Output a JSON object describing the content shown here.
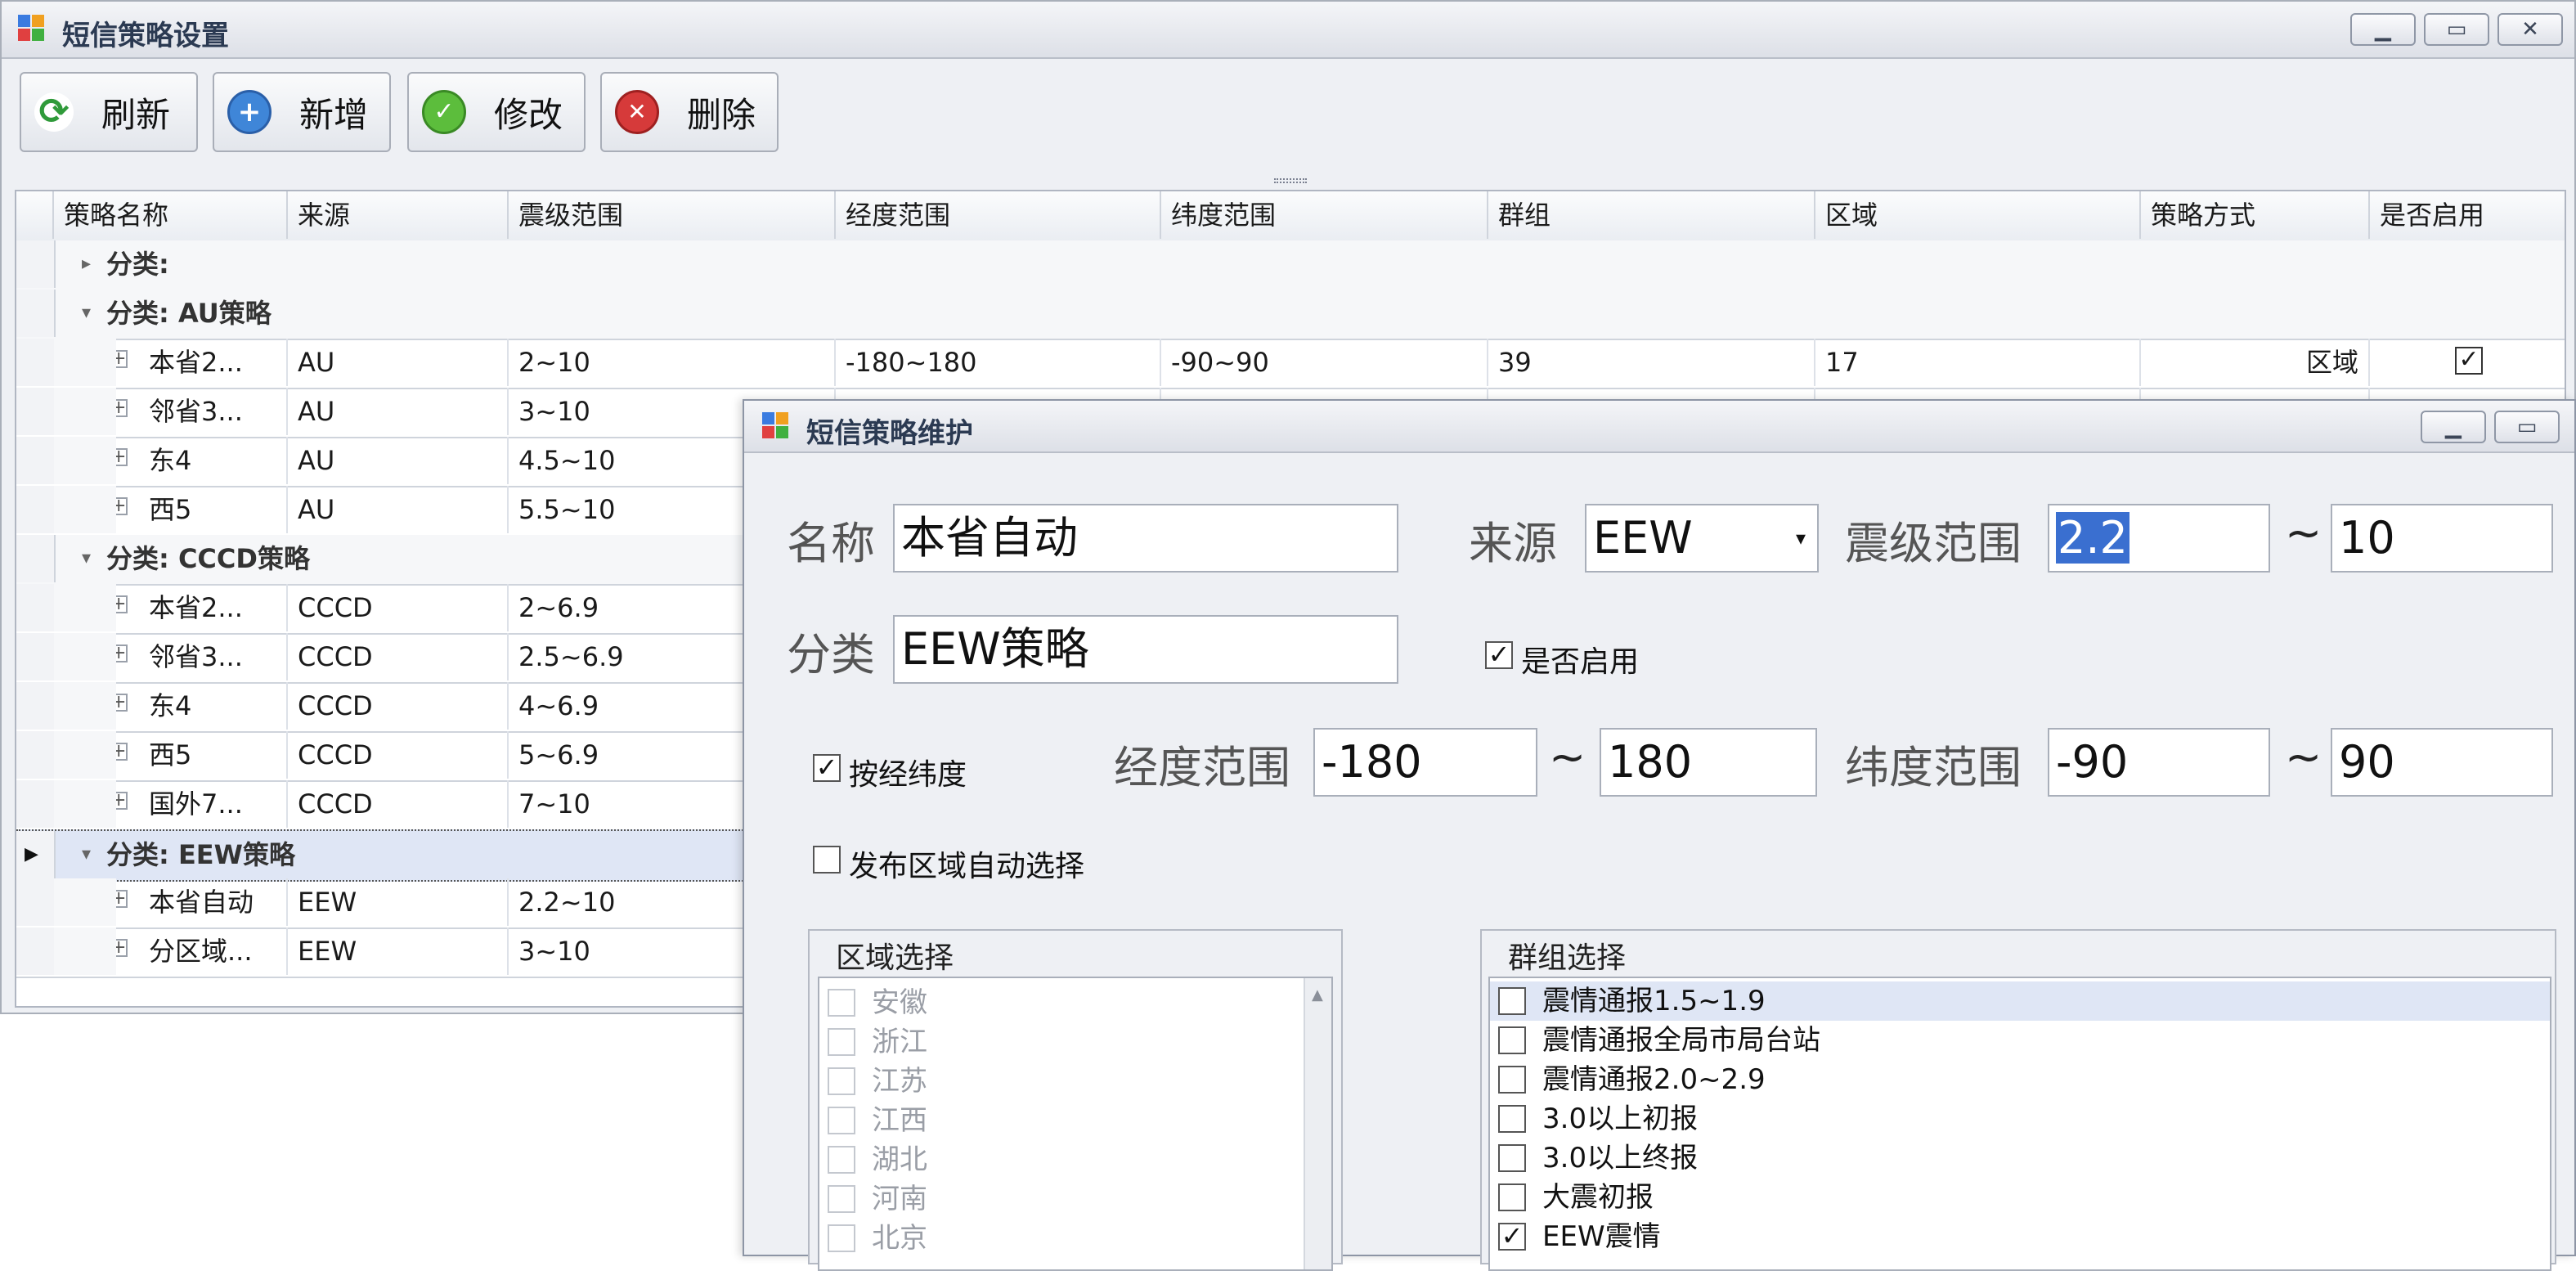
{
  "main_window": {
    "title": "短信策略设置",
    "controls": {
      "minimize": "▁",
      "maximize": "▭",
      "close": "✕"
    }
  },
  "toolbar": {
    "refresh": "刷新",
    "add": "新增",
    "edit": "修改",
    "delete": "删除"
  },
  "grid": {
    "columns": [
      "策略名称",
      "来源",
      "震级范围",
      "经度范围",
      "纬度范围",
      "群组",
      "区域",
      "策略方式",
      "是否启用"
    ],
    "groups": [
      {
        "label": "分类:",
        "expanded": false,
        "rows": []
      },
      {
        "label": "分类: AU策略",
        "expanded": true,
        "rows": [
          {
            "name": "本省2...",
            "source": "AU",
            "mag": "2~10",
            "lon": "-180~180",
            "lat": "-90~90",
            "group": "39",
            "region": "17",
            "mode": "区域",
            "enabled": true
          },
          {
            "name": "邻省3...",
            "source": "AU",
            "mag": "3~10"
          },
          {
            "name": "东4",
            "source": "AU",
            "mag": "4.5~10"
          },
          {
            "name": "西5",
            "source": "AU",
            "mag": "5.5~10"
          }
        ]
      },
      {
        "label": "分类: CCCD策略",
        "expanded": true,
        "rows": [
          {
            "name": "本省2...",
            "source": "CCCD",
            "mag": "2~6.9"
          },
          {
            "name": "邻省3...",
            "source": "CCCD",
            "mag": "2.5~6.9"
          },
          {
            "name": "东4",
            "source": "CCCD",
            "mag": "4~6.9"
          },
          {
            "name": "西5",
            "source": "CCCD",
            "mag": "5~6.9"
          },
          {
            "name": "国外7...",
            "source": "CCCD",
            "mag": "7~10"
          }
        ]
      },
      {
        "label": "分类: EEW策略",
        "expanded": true,
        "selected": true,
        "rows": [
          {
            "name": "本省自动",
            "source": "EEW",
            "mag": "2.2~10"
          },
          {
            "name": "分区域...",
            "source": "EEW",
            "mag": "3~10"
          }
        ]
      }
    ]
  },
  "dialog": {
    "title": "短信策略维护",
    "controls": {
      "minimize": "▁",
      "maximize": "▭"
    },
    "name_label": "名称",
    "name_value": "本省自动",
    "source_label": "来源",
    "source_value": "EEW",
    "mag_label": "震级范围",
    "mag_min": "2.2",
    "mag_max": "10",
    "tilde": "~",
    "category_label": "分类",
    "category_value": "EEW策略",
    "enabled_label": "是否启用",
    "enabled": true,
    "by_lonlat_label": "按经纬度",
    "by_lonlat": true,
    "lon_label": "经度范围",
    "lon_min": "-180",
    "lon_max": "180",
    "lat_label": "纬度范围",
    "lat_min": "-90",
    "lat_max": "90",
    "auto_region_label": "发布区域自动选择",
    "auto_region": false,
    "region_box_title": "区域选择",
    "regions": [
      "安徽",
      "浙江",
      "江苏",
      "江西",
      "湖北",
      "河南",
      "北京"
    ],
    "group_box_title": "群组选择",
    "groups": [
      {
        "label": "震情通报1.5~1.9",
        "checked": false
      },
      {
        "label": "震情通报全局市局台站",
        "checked": false
      },
      {
        "label": "震情通报2.0~2.9",
        "checked": false
      },
      {
        "label": "3.0以上初报",
        "checked": false
      },
      {
        "label": "3.0以上终报",
        "checked": false
      },
      {
        "label": "大震初报",
        "checked": false
      },
      {
        "label": "EEW震情",
        "checked": true
      }
    ]
  },
  "colors": {
    "selection_blue": "#3a6fd0",
    "accent_header": "#2b3a52"
  }
}
